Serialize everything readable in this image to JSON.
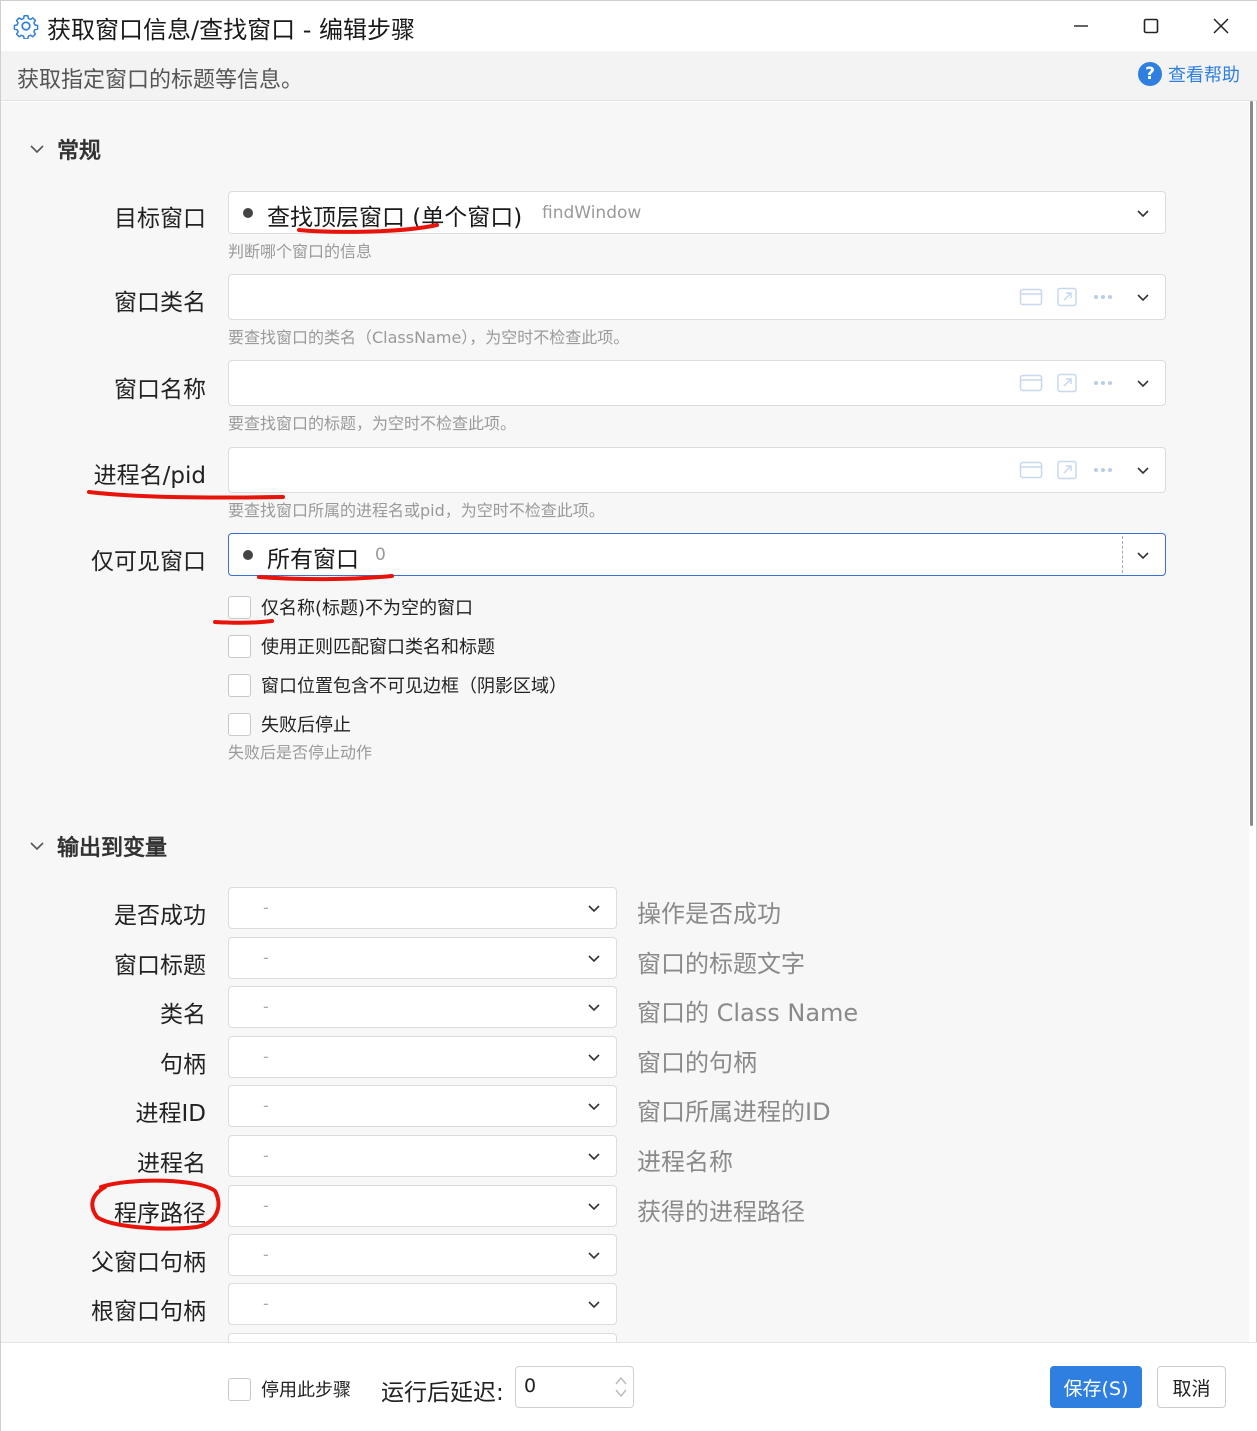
{
  "window": {
    "title": "获取窗口信息/查找窗口  -  编辑步骤",
    "description": "获取指定窗口的标题等信息。",
    "help_label": "查看帮助"
  },
  "general": {
    "section_title": "常规",
    "target_window": {
      "label": "目标窗口",
      "value": "查找顶层窗口 (单个窗口)",
      "value_code": "findWindow",
      "hint": "判断哪个窗口的信息"
    },
    "class_name": {
      "label": "窗口类名",
      "value": "",
      "hint": "要查找窗口的类名（ClassName），为空时不检查此项。"
    },
    "window_name": {
      "label": "窗口名称",
      "value": "",
      "hint": "要查找窗口的标题，为空时不检查此项。"
    },
    "process": {
      "label": "进程名/pid",
      "value": "",
      "hint": "要查找窗口所属的进程名或pid，为空时不检查此项。"
    },
    "visible_only": {
      "label": "仅可见窗口",
      "value": "所有窗口",
      "value_code": "0"
    },
    "checkboxes": [
      {
        "label": "仅名称(标题)不为空的窗口",
        "checked": false
      },
      {
        "label": "使用正则匹配窗口类名和标题",
        "checked": false
      },
      {
        "label": "窗口位置包含不可见边框（阴影区域）",
        "checked": false
      },
      {
        "label": "失败后停止",
        "checked": false
      }
    ],
    "stop_hint": "失败后是否停止动作"
  },
  "output": {
    "section_title": "输出到变量",
    "rows": [
      {
        "label": "是否成功",
        "value": "-",
        "desc": "操作是否成功"
      },
      {
        "label": "窗口标题",
        "value": "-",
        "desc": "窗口的标题文字"
      },
      {
        "label": "类名",
        "value": "-",
        "desc": "窗口的 Class Name"
      },
      {
        "label": "句柄",
        "value": "-",
        "desc": "窗口的句柄"
      },
      {
        "label": "进程ID",
        "value": "-",
        "desc": "窗口所属进程的ID"
      },
      {
        "label": "进程名",
        "value": "-",
        "desc": "进程名称"
      },
      {
        "label": "程序路径",
        "value": "-",
        "desc": "获得的进程路径"
      },
      {
        "label": "父窗口句柄",
        "value": "-",
        "desc": ""
      },
      {
        "label": "根窗口句柄",
        "value": "-",
        "desc": ""
      }
    ]
  },
  "footer": {
    "disable_label": "停用此步骤",
    "delay_label": "运行后延迟:",
    "delay_value": "0",
    "save_label": "保存(S)",
    "cancel_label": "取消"
  },
  "colors": {
    "accent": "#2f7fe0",
    "annotation": "#e8140c"
  }
}
